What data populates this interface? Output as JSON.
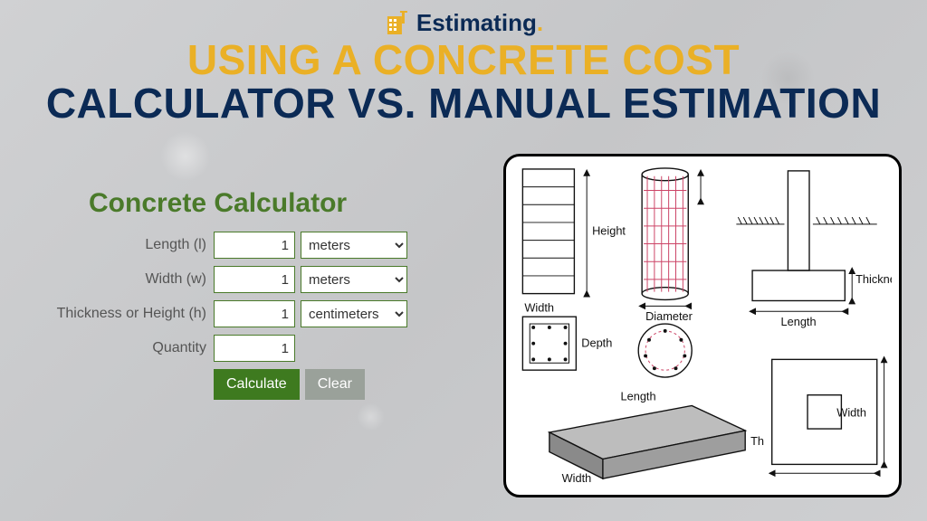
{
  "logo": {
    "text": "Estimating",
    "dot": "."
  },
  "headline": {
    "line1": "USING A CONCRETE COST",
    "line2": "CALCULATOR VS. MANUAL ESTIMATION"
  },
  "calculator": {
    "title": "Concrete Calculator",
    "rows": {
      "length": {
        "label": "Length (l)",
        "value": "1",
        "unit": "meters"
      },
      "width": {
        "label": "Width (w)",
        "value": "1",
        "unit": "meters"
      },
      "height": {
        "label": "Thickness or Height (h)",
        "value": "1",
        "unit": "centimeters"
      },
      "quantity": {
        "label": "Quantity",
        "value": "1"
      }
    },
    "buttons": {
      "calculate": "Calculate",
      "clear": "Clear"
    }
  },
  "diagram": {
    "labels": {
      "height": "Height",
      "width": "Width",
      "depth": "Depth",
      "diameter": "Diameter",
      "thickness": "Thickness",
      "length": "Length",
      "length2": "Length",
      "width2": "Width",
      "width3": "Width",
      "th": "Th"
    }
  }
}
